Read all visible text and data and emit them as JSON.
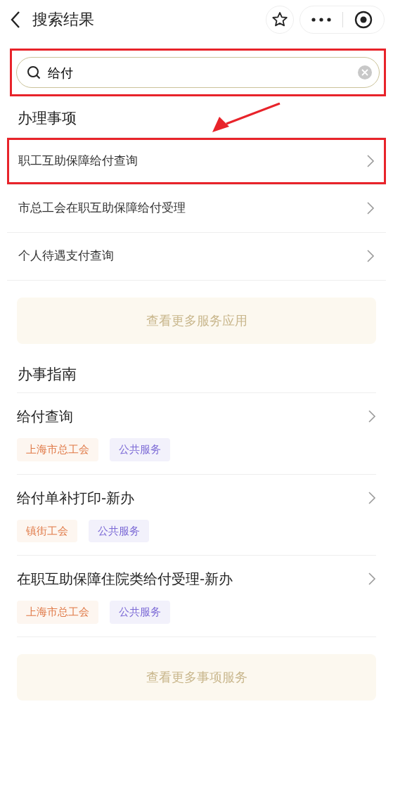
{
  "header": {
    "title": "搜索结果"
  },
  "search": {
    "value": "给付",
    "highlighted": true
  },
  "sections": [
    {
      "title": "办理事项",
      "items": [
        {
          "label": "职工互助保障给付查询",
          "highlighted": true
        },
        {
          "label": "市总工会在职互助保障给付受理",
          "highlighted": false
        },
        {
          "label": "个人待遇支付查询",
          "highlighted": false
        }
      ],
      "more_button": "查看更多服务应用"
    },
    {
      "title": "办事指南",
      "items": [
        {
          "label": "给付查询",
          "highlighted": false,
          "tags": [
            {
              "text": "上海市总工会",
              "kind": "org"
            },
            {
              "text": "公共服务",
              "kind": "category"
            }
          ]
        },
        {
          "label": "给付单补打印-新办",
          "highlighted": false,
          "tags": [
            {
              "text": "镇街工会",
              "kind": "org"
            },
            {
              "text": "公共服务",
              "kind": "category"
            }
          ]
        },
        {
          "label": "在职互助保障住院类给付受理-新办",
          "highlighted": false,
          "tags": [
            {
              "text": "上海市总工会",
              "kind": "org"
            },
            {
              "text": "公共服务",
              "kind": "category"
            }
          ]
        }
      ],
      "more_button": "查看更多事项服务"
    }
  ],
  "annotation": {
    "arrow": true
  }
}
